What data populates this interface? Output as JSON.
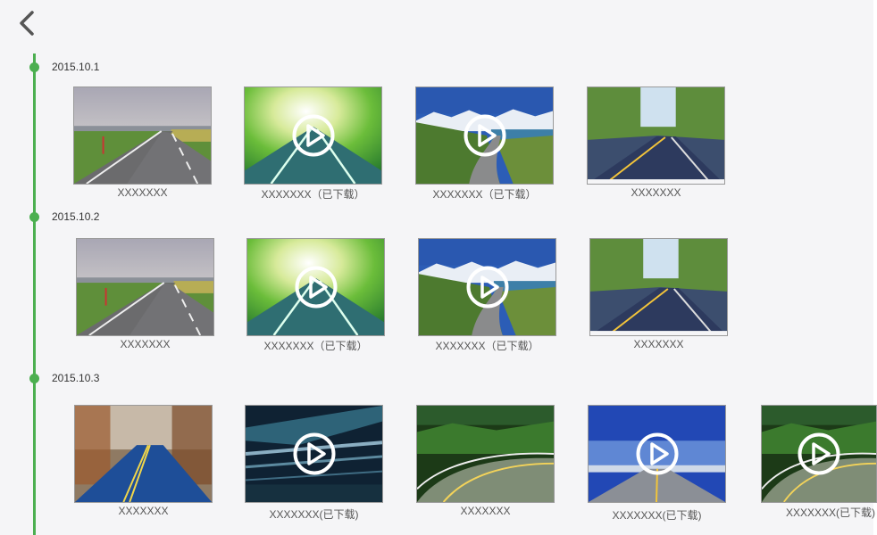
{
  "groups": [
    {
      "date": "2015.10.1",
      "items": [
        {
          "caption": "XXXXXXX",
          "video": false,
          "scene": "road-pasture"
        },
        {
          "caption": "XXXXXXX（已下载）",
          "video": true,
          "scene": "road-blur-green"
        },
        {
          "caption": "XXXXXXX（已下载）",
          "video": true,
          "scene": "road-mountain-lake"
        },
        {
          "caption": "XXXXXXX",
          "video": false,
          "scene": "road-forest-blur"
        }
      ]
    },
    {
      "date": "2015.10.2",
      "items": [
        {
          "caption": "XXXXXXX",
          "video": false,
          "scene": "road-pasture"
        },
        {
          "caption": "XXXXXXX（已下载）",
          "video": true,
          "scene": "road-blur-green"
        },
        {
          "caption": "XXXXXXX（已下载）",
          "video": true,
          "scene": "road-mountain-lake"
        },
        {
          "caption": "XXXXXXX",
          "video": false,
          "scene": "road-forest-blur"
        }
      ]
    },
    {
      "date": "2015.10.3",
      "items": [
        {
          "caption": "XXXXXXX",
          "video": false,
          "scene": "road-autumn-blue"
        },
        {
          "caption": "XXXXXXX(已下载)",
          "video": true,
          "scene": "tunnel-light-trails"
        },
        {
          "caption": "XXXXXXX",
          "video": false,
          "scene": "road-green-hills"
        },
        {
          "caption": "XXXXXXX(已下载)",
          "video": true,
          "scene": "road-blue-sky"
        },
        {
          "caption": "XXXXXXX(已下载)",
          "video": true,
          "scene": "road-green-hills"
        }
      ]
    }
  ],
  "icons": {
    "back": "chevron-left-icon",
    "play": "play-circle-icon"
  },
  "colors": {
    "timeline": "#4caf50",
    "panel": "#f5f5f7",
    "caption": "#555555"
  }
}
